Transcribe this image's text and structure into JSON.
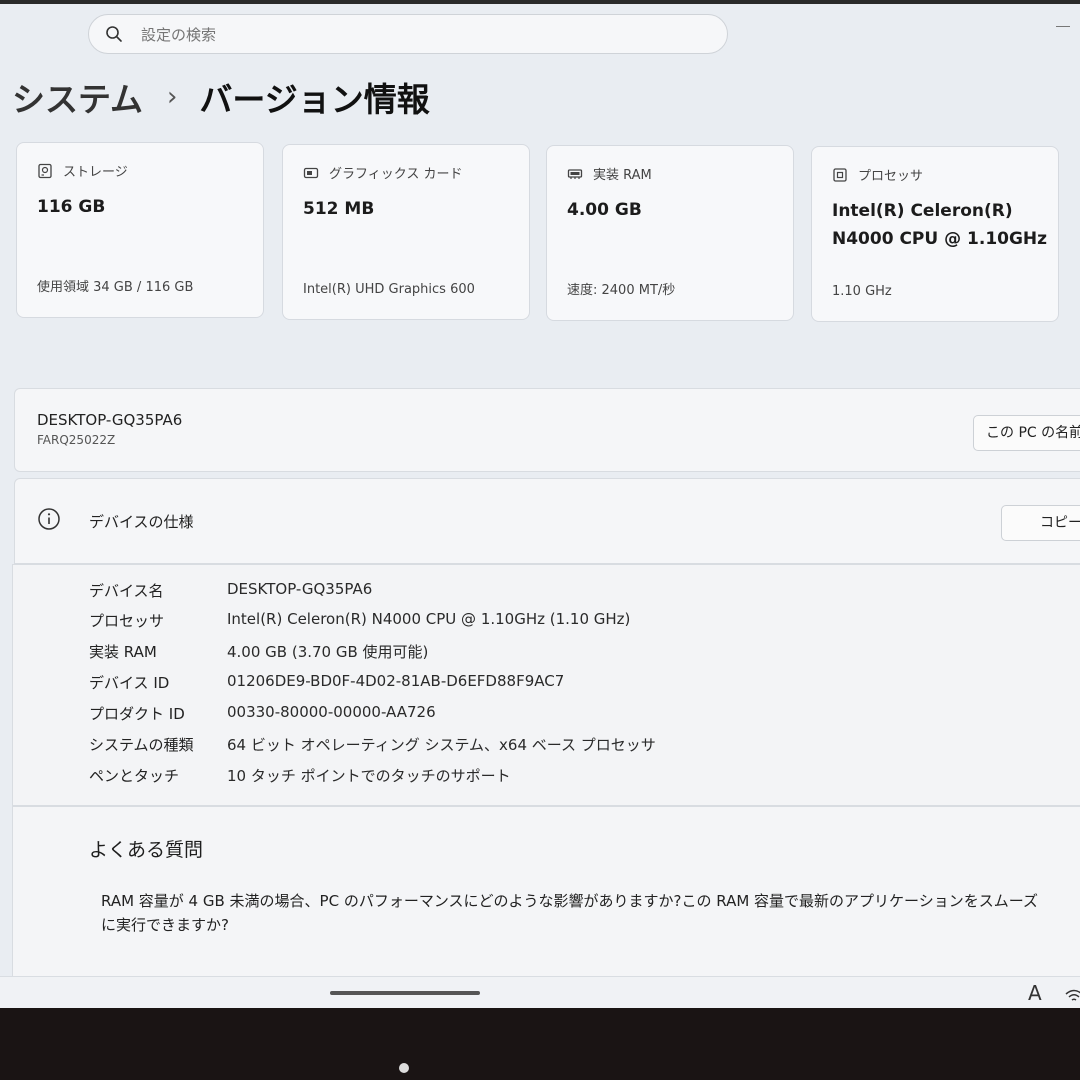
{
  "search": {
    "placeholder": "設定の検索"
  },
  "breadcrumb": {
    "parent": "システム",
    "separator": "›",
    "current": "バージョン情報"
  },
  "cards": [
    {
      "icon": "storage-icon",
      "label": "ストレージ",
      "value": "116 GB",
      "sub": "使用領域 34 GB / 116 GB"
    },
    {
      "icon": "graphics-card-icon",
      "label": "グラフィックス カード",
      "value": "512 MB",
      "sub": "Intel(R) UHD Graphics 600"
    },
    {
      "icon": "ram-icon",
      "label": "実装 RAM",
      "value": "4.00 GB",
      "sub": "速度: 2400 MT/秒"
    },
    {
      "icon": "processor-icon",
      "label": "プロセッサ",
      "value": "Intel(R) Celeron(R) N4000 CPU @ 1.10GHz",
      "sub": "1.10 GHz"
    }
  ],
  "device": {
    "name": "DESKTOP-GQ35PA6",
    "model": "FARQ25022Z",
    "rename_button": "この PC の名前を変更"
  },
  "specs": {
    "title": "デバイスの仕様",
    "copy_button": "コピー",
    "rows": [
      {
        "key": "デバイス名",
        "value": "DESKTOP-GQ35PA6"
      },
      {
        "key": "プロセッサ",
        "value": "Intel(R) Celeron(R) N4000 CPU @ 1.10GHz (1.10 GHz)"
      },
      {
        "key": "実装 RAM",
        "value": "4.00 GB (3.70 GB 使用可能)"
      },
      {
        "key": "デバイス ID",
        "value": "01206DE9-BD0F-4D02-81AB-D6EFD88F9AC7"
      },
      {
        "key": "プロダクト ID",
        "value": "00330-80000-00000-AA726"
      },
      {
        "key": "システムの種類",
        "value": "64 ビット オペレーティング システム、x64 ベース プロセッサ"
      },
      {
        "key": "ペンとタッチ",
        "value": "10 タッチ ポイントでのタッチのサポート"
      }
    ]
  },
  "faq": {
    "title": "よくある質問",
    "question_line1": "RAM 容量が 4 GB 未満の場合、PC のパフォーマンスにどのような影響がありますか?この RAM 容量で最新のアプリケーションをスムーズ",
    "question_line2": "に実行できますか?"
  },
  "taskbar": {
    "ime_indicator": "A"
  }
}
